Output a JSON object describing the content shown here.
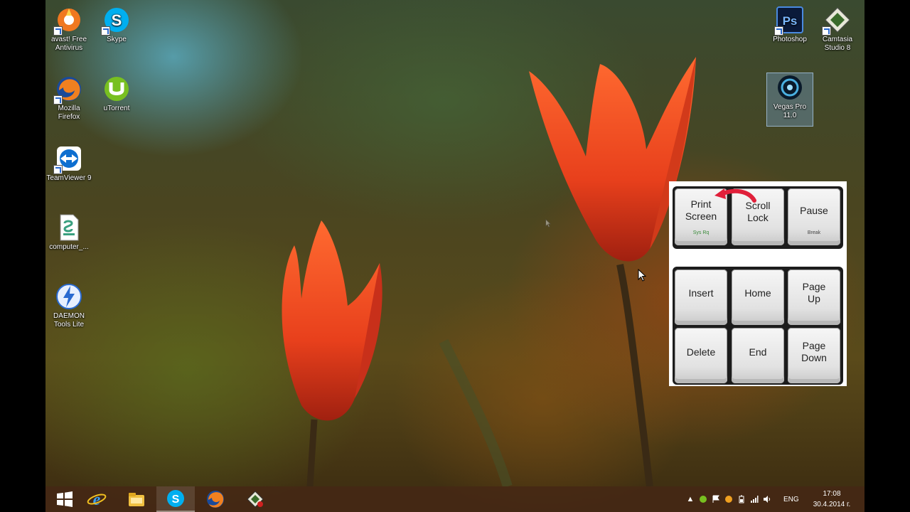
{
  "desktop": {
    "icons": [
      {
        "id": "avast",
        "label": "avast! Free Antivirus",
        "icon": "avast-icon"
      },
      {
        "id": "skype",
        "label": "Skype",
        "icon": "skype-icon"
      },
      {
        "id": "firefox",
        "label": "Mozilla Firefox",
        "icon": "firefox-icon"
      },
      {
        "id": "utorrent",
        "label": "uTorrent",
        "icon": "utorrent-icon"
      },
      {
        "id": "teamviewer",
        "label": "TeamViewer 9",
        "icon": "teamviewer-icon"
      },
      {
        "id": "computer",
        "label": "computer_...",
        "icon": "script-file-icon"
      },
      {
        "id": "daemon",
        "label": "DAEMON Tools Lite",
        "icon": "daemon-tools-icon"
      },
      {
        "id": "photoshop",
        "label": "Photoshop",
        "icon": "photoshop-icon"
      },
      {
        "id": "camtasia",
        "label": "Camtasia Studio 8",
        "icon": "camtasia-icon"
      },
      {
        "id": "vegas",
        "label": "Vegas Pro 11.0",
        "icon": "vegas-pro-icon"
      }
    ]
  },
  "keyboard_overlay": {
    "print_screen": {
      "label": "Print Screen",
      "sub": "Sys Rq"
    },
    "scroll_lock": {
      "label": "Scroll Lock"
    },
    "pause": {
      "label": "Pause",
      "sub": "Break"
    },
    "insert": "Insert",
    "home": "Home",
    "page_up": "Page Up",
    "delete": "Delete",
    "end": "End",
    "page_down": "Page Down",
    "arrow_color": "#e0203a"
  },
  "taskbar": {
    "pinned": [
      {
        "id": "start",
        "icon": "windows-logo-icon"
      },
      {
        "id": "ie",
        "icon": "internet-explorer-icon"
      },
      {
        "id": "explorer",
        "icon": "file-explorer-icon"
      },
      {
        "id": "skype",
        "icon": "skype-icon",
        "active": true
      },
      {
        "id": "firefox",
        "icon": "firefox-icon"
      },
      {
        "id": "camtasia",
        "icon": "camtasia-recorder-icon"
      }
    ],
    "tray": {
      "language": "ENG",
      "time": "17:08",
      "date": "30.4.2014 г."
    }
  },
  "colors": {
    "taskbar": "#46281488",
    "skype_blue": "#00aff0",
    "photoshop_blue": "#2a4a8c",
    "flower_red": "#e8401c"
  }
}
